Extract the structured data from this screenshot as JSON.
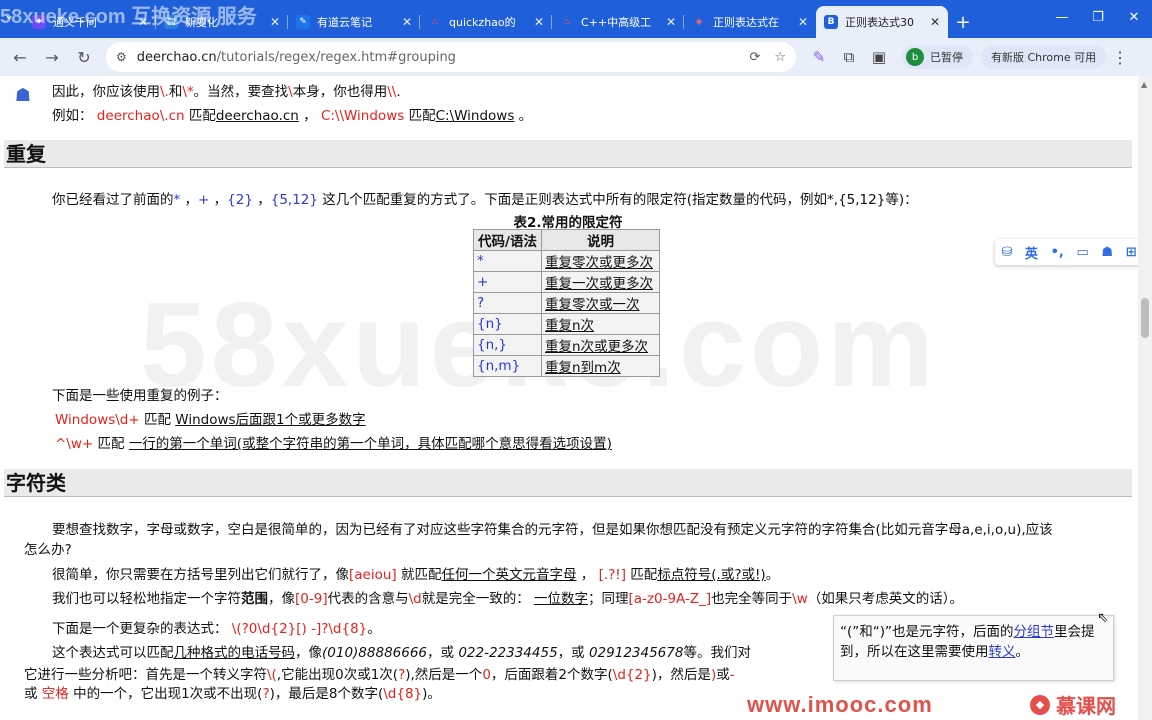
{
  "tabs": [
    {
      "label": "通义千问",
      "icon": "tongyi-icon",
      "color": "#6b4cf6"
    },
    {
      "label": "新变化",
      "icon": "doc-icon",
      "color": "#2a7de1"
    },
    {
      "label": "有道云笔记",
      "icon": "note-icon",
      "color": "#1a73e8"
    },
    {
      "label": "quickzhao的",
      "icon": "flame-icon",
      "color": "#e53935"
    },
    {
      "label": "C++中高级工",
      "icon": "flame-icon",
      "color": "#e53935"
    },
    {
      "label": "正则表达式在",
      "icon": "cube-icon",
      "color": "#d9302c"
    },
    {
      "label": "正则表达式30",
      "icon": "b-icon",
      "color": "#1f5fd9",
      "active": true
    }
  ],
  "address": {
    "domain": "deerchao.cn",
    "path": "/tutorials/regex/regex.htm#grouping"
  },
  "profile": {
    "initial": "b",
    "status": "已暂停"
  },
  "update_label": "有新版 Chrome 可用",
  "overlay_watermark": "58xueke.com  互换资源 服务",
  "content": {
    "intro_line1": {
      "a": "因此，你应该使用",
      "b": "\\.",
      "c": "和",
      "d": "\\*",
      "e": "。当然，要查找",
      "f": "\\",
      "g": "本身，你也得用",
      "h": "\\\\",
      "i": "."
    },
    "intro_line2": {
      "a": "例如：",
      "b": "deerchao\\.cn",
      "c": "匹配",
      "d": "deerchao.cn",
      "e": "，",
      "f": "C:\\\\Windows",
      "g": "匹配",
      "h": "C:\\Windows",
      "i": "。"
    },
    "heading_repeat": "重复",
    "repeat_intro": {
      "a": "你已经看过了前面的",
      "b": "*",
      "c": "，",
      "d": "+",
      "e": "，",
      "f": "{2}",
      "g": "，",
      "h": "{5,12}",
      "i": "这几个匹配重复的方式了。下面是正则表达式中所有的限定符(指定数量的代码，例如*,{5,12}等)："
    },
    "table_caption": "表2.常用的限定符",
    "table_headers": [
      "代码/语法",
      "说明"
    ],
    "table_rows": [
      {
        "code": "*",
        "desc": "重复零次或更多次"
      },
      {
        "code": "+",
        "desc": "重复一次或更多次"
      },
      {
        "code": "?",
        "desc": "重复零次或一次"
      },
      {
        "code": "{n}",
        "desc": "重复n次"
      },
      {
        "code": "{n,}",
        "desc": "重复n次或更多次"
      },
      {
        "code": "{n,m}",
        "desc": "重复n到m次"
      }
    ],
    "examples_intro": "下面是一些使用重复的例子：",
    "example1": {
      "code": "Windows\\d+",
      "mid": "匹配",
      "desc": "Windows后面跟1个或更多数字"
    },
    "example2": {
      "code": "^\\w+",
      "mid": "匹配",
      "desc": "一行的第一个单词(或整个字符串的第一个单词，具体匹配哪个意思得看选项设置)"
    },
    "heading_charclass": "字符类",
    "cc_para1a": "要想查找数字，字母或数字，空白是很简单的，因为已经有了对应这些字符集合的元字符，但是如果你想匹配没有预定义元字符的字符集合(比如元音字母a,e,i,o,u),应该",
    "cc_para1b": "怎么办?",
    "cc_para2": {
      "a": "很简单，你只需要在方括号里列出它们就行了，像",
      "b": "[aeiou]",
      "c": "就匹配",
      "d": "任何一个英文元音字母",
      "e": "，",
      "f": "[.?!]",
      "g": "匹配",
      "h": "标点符号(.或?或!)",
      "i": "。"
    },
    "cc_para3": {
      "a": "我们也可以轻松地指定一个字符",
      "b": "范围",
      "c": "，像",
      "d": "[0-9]",
      "e": "代表的含意与",
      "f": "\\d",
      "g": "就是完全一致的：",
      "h": "一位数字",
      "i": "；同理",
      "j": "[a-z0-9A-Z_]",
      "k": "也完全等同于",
      "l": "\\w",
      "m": "（如果只考虑英文的话）。"
    },
    "cc_para4": {
      "a": "下面是一个更复杂的表达式：",
      "b": "\\(?0\\d{2}[) -]?\\d{8}",
      "c": "。"
    },
    "cc_para5": {
      "a": "这个表达式可以匹配",
      "b": "几种格式的电话号码",
      "c": "，像",
      "d": "(010)88886666",
      "e": "，或",
      "f": "022-22334455",
      "g": "，或",
      "h": "02912345678",
      "i": "等。我们对"
    },
    "cc_para6": {
      "a": "它进行一些分析吧：首先是一个转义字符",
      "b": "\\(",
      "c": ",它能出现0次或1次(",
      "d": "?",
      "e": "),然后是一个",
      "f": "0",
      "g": "，后面跟着2个数字(",
      "h": "\\d{2}",
      "i": ")，然后是",
      "j": ")",
      "k": "或",
      "l": "-"
    },
    "cc_para7": {
      "a": "或",
      "b": "空格",
      "c": "中的一个，它出现1次或不出现(",
      "d": "?",
      "e": ")，最后是8个数字(",
      "f": "\\d{8}",
      "g": ")。"
    },
    "tip": {
      "a": "“(”和“)”也是元字符，后面的",
      "b": "分组节",
      "c": "里会提到，所以在这里需要使用",
      "d": "转义",
      "e": "。"
    }
  },
  "floatbar": [
    "du-icon",
    "英",
    "dot-icon",
    "window-icon",
    "avatar-icon",
    "grid-icon"
  ],
  "page_watermark": "58xueke.com",
  "brand": {
    "imooc_url": "www.imooc.com",
    "imooc_name": "慕课网"
  }
}
